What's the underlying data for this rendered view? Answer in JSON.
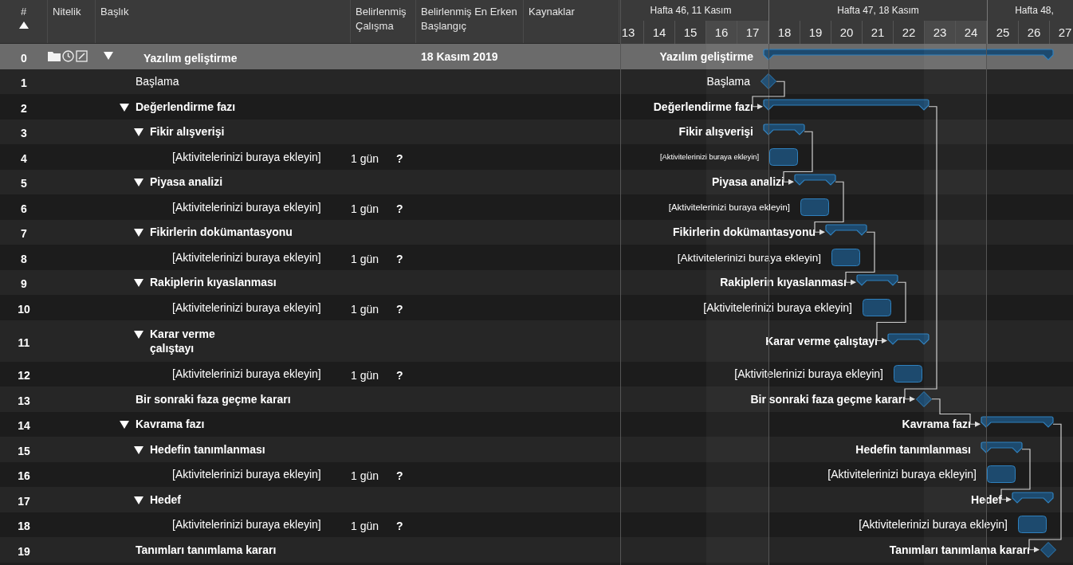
{
  "table": {
    "columns": [
      {
        "label": "#",
        "sorted": true
      },
      {
        "label": "Nitelik",
        "sorted": false
      },
      {
        "label": "Başlık",
        "sorted": false
      },
      {
        "label": "Belirlenmiş Çalışma",
        "sorted": false
      },
      {
        "label": "Belirlenmiş En Erken Başlangıç",
        "sorted": false
      },
      {
        "label": "Kaynaklar",
        "sorted": false
      }
    ]
  },
  "timeline": {
    "weeks": [
      {
        "label": "Hafta 46, 11 Kasım",
        "days": [
          {
            "label": "13",
            "weekend": false
          },
          {
            "label": "14",
            "weekend": false
          },
          {
            "label": "15",
            "weekend": false
          },
          {
            "label": "16",
            "weekend": true
          },
          {
            "label": "17",
            "weekend": true
          }
        ]
      },
      {
        "label": "Hafta 47, 18 Kasım",
        "days": [
          {
            "label": "18",
            "weekend": false
          },
          {
            "label": "19",
            "weekend": false
          },
          {
            "label": "20",
            "weekend": false
          },
          {
            "label": "21",
            "weekend": false
          },
          {
            "label": "22",
            "weekend": false
          },
          {
            "label": "23",
            "weekend": true
          },
          {
            "label": "24",
            "weekend": true
          }
        ]
      },
      {
        "label": "Hafta 48,",
        "days": [
          {
            "label": "25",
            "weekend": false
          },
          {
            "label": "26",
            "weekend": false
          },
          {
            "label": "27",
            "weekend": false
          }
        ]
      }
    ]
  },
  "rows": [
    {
      "number": "0",
      "title": "Yazılım geliştirme",
      "bold": true,
      "selected": true,
      "expanded": true,
      "start": "18 Kasım 2019",
      "gantt_label": "Yazılım geliştirme",
      "children": [
        {
          "number": "1",
          "title": "Başlama",
          "bold": false,
          "selected": false,
          "gantt_label": "Başlama"
        },
        {
          "number": "2",
          "title": "Değerlendirme fazı",
          "bold": true,
          "selected": false,
          "expanded": true,
          "linked": true,
          "gantt_label": "Değerlendirme fazı",
          "children": [
            {
              "number": "3",
              "title": "Fikir alışverişi",
              "bold": true,
              "selected": false,
              "expanded": true,
              "gantt_label": "Fikir alışverişi",
              "children": [
                {
                  "number": "4",
                  "title": "[Aktivitelerinizi buraya ekleyin]",
                  "bold": false,
                  "selected": false,
                  "work": "1 gün",
                  "estimate": "?",
                  "gantt_label": "[Aktivitelerinizi buraya ekleyin]"
                }
              ]
            },
            {
              "number": "5",
              "title": "Piyasa analizi",
              "bold": true,
              "selected": false,
              "expanded": true,
              "linked": true,
              "gantt_label": "Piyasa analizi",
              "children": [
                {
                  "number": "6",
                  "title": "[Aktivitelerinizi buraya ekleyin]",
                  "bold": false,
                  "selected": false,
                  "work": "1 gün",
                  "estimate": "?",
                  "gantt_label": "[Aktivitelerinizi buraya ekleyin]"
                }
              ]
            },
            {
              "number": "7",
              "title": "Fikirlerin dokümantasyonu",
              "bold": true,
              "selected": false,
              "expanded": true,
              "linked": true,
              "gantt_label": "Fikirlerin dokümantasyonu",
              "children": [
                {
                  "number": "8",
                  "title": "[Aktivitelerinizi buraya ekleyin]",
                  "bold": false,
                  "selected": false,
                  "work": "1 gün",
                  "estimate": "?",
                  "gantt_label": "[Aktivitelerinizi buraya ekleyin]"
                }
              ]
            },
            {
              "number": "9",
              "title": "Rakiplerin kıyaslanması",
              "bold": true,
              "selected": false,
              "expanded": true,
              "linked": true,
              "gantt_label": "Rakiplerin kıyaslanması",
              "children": [
                {
                  "number": "10",
                  "title": "[Aktivitelerinizi buraya ekleyin]",
                  "bold": false,
                  "selected": false,
                  "work": "1 gün",
                  "estimate": "?",
                  "gantt_label": "[Aktivitelerinizi buraya ekleyin]"
                }
              ]
            },
            {
              "number": "11",
              "title": "Karar verme\nçalıştayı",
              "bold": true,
              "selected": false,
              "expanded": true,
              "linked": true,
              "gantt_label": "Karar verme çalıştayı",
              "children": [
                {
                  "number": "12",
                  "title": "[Aktivitelerinizi buraya ekleyin]",
                  "bold": false,
                  "selected": false,
                  "work": "1 gün",
                  "estimate": "?",
                  "gantt_label": "[Aktivitelerinizi buraya ekleyin]"
                }
              ]
            }
          ]
        },
        {
          "number": "13",
          "title": "Bir sonraki faza geçme kararı",
          "bold": true,
          "selected": false,
          "linked": true,
          "gantt_label": "Bir sonraki faza geçme kararı"
        },
        {
          "number": "14",
          "title": "Kavrama fazı",
          "bold": true,
          "selected": false,
          "expanded": true,
          "linked": true,
          "gantt_label": "Kavrama fazı",
          "children": [
            {
              "number": "15",
              "title": "Hedefin tanımlanması",
              "bold": true,
              "selected": false,
              "expanded": true,
              "gantt_label": "Hedefin tanımlanması",
              "children": [
                {
                  "number": "16",
                  "title": "[Aktivitelerinizi buraya ekleyin]",
                  "bold": false,
                  "selected": false,
                  "work": "1 gün",
                  "estimate": "?",
                  "gantt_label": "[Aktivitelerinizi buraya ekleyin]"
                }
              ]
            },
            {
              "number": "17",
              "title": "Hedef",
              "bold": true,
              "selected": false,
              "expanded": true,
              "linked": true,
              "gantt_label": "Hedef",
              "children": [
                {
                  "number": "18",
                  "title": "[Aktivitelerinizi buraya ekleyin]",
                  "bold": false,
                  "selected": false,
                  "work": "1 gün",
                  "estimate": "?",
                  "gantt_label": "[Aktivitelerinizi buraya ekleyin]"
                }
              ]
            }
          ]
        },
        {
          "number": "19",
          "title": "Tanımları tanımlama kararı",
          "bold": true,
          "selected": false,
          "linked": true,
          "gantt_label": "Tanımları tanımlama kararı"
        }
      ]
    }
  ]
}
